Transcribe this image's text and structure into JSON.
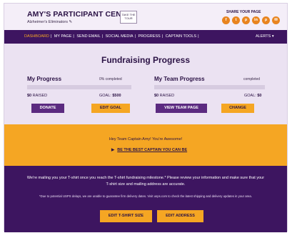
{
  "header": {
    "title": "AMY'S PARTICIPANT CENTER",
    "team_name": "Alzheimer's Eliminators ✎",
    "tour_button": "TAKE THE TOUR",
    "share_label": "SHARE YOUR PAGE",
    "social_icons": [
      "facebook-icon",
      "twitter-icon",
      "pinterest-icon",
      "linkedin-icon",
      "pinterest-icon",
      "email-icon"
    ]
  },
  "nav": {
    "items": [
      "DASHBOARD",
      "MY PAGE",
      "SEND EMAIL",
      "SOCIAL MEDIA",
      "PROGRESS",
      "CAPTAIN TOOLS"
    ],
    "active": "DASHBOARD",
    "alerts": "ALERTS ▾"
  },
  "progress": {
    "title": "Fundraising Progress",
    "my": {
      "heading": "My Progress",
      "completed": "0% completed",
      "percent": 0,
      "raised_amount": "$0",
      "raised_label": "RAISED",
      "goal_label": "GOAL:",
      "goal_amount": "$500",
      "primary_button": "DONATE",
      "secondary_button": "EDIT GOAL"
    },
    "team": {
      "heading": "My Team Progress",
      "completed": "completed",
      "percent": 0,
      "raised_amount": "$0",
      "raised_label": "RAISED",
      "goal_label": "GOAL:",
      "goal_amount": "$0",
      "primary_button": "VIEW TEAM PAGE",
      "secondary_button": "CHANGE"
    }
  },
  "banner": {
    "greeting": "Hey Team Captain Amy! You're Awesome!",
    "link": "BE THE BEST CAPTAIN YOU CAN BE"
  },
  "tshirt": {
    "message": "We're mailing you your T-shirt once you reach the T-shirt fundraising milestone.* Please review your information and make sure that your T-shirt size and mailing address are accurate.",
    "note": "*Due to potential USPS delays, we are unable to guarantee firm delivery dates. Visit usps.com to check the latest shipping and delivery updates in your area.",
    "edit_size_button": "EDIT T-SHIRT SIZE",
    "edit_address_button": "EDIT ADDRESS"
  },
  "colors": {
    "purple_dark": "#3d1560",
    "purple_button": "#5b2a80",
    "orange": "#f5a623",
    "lavender": "#ebe2f2"
  }
}
